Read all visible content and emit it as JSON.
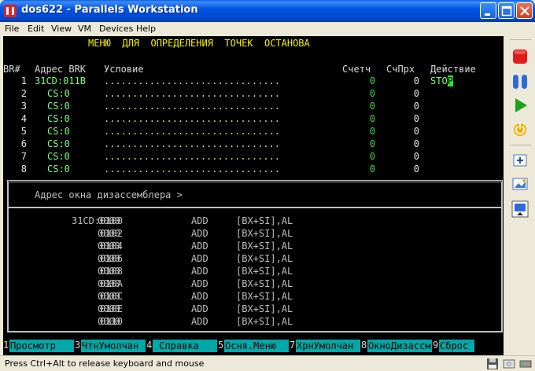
{
  "window": {
    "title": "dos622 - Parallels Workstation",
    "icon": "parallels-logo-icon"
  },
  "menu": [
    "File",
    "Edit",
    "View",
    "VM",
    "Devices",
    "Help"
  ],
  "dos": {
    "heading": "МЕНЮ  ДЛЯ  ОПРЕДЕЛЕНИЯ  ТОЧЕК  ОСТАНОВА",
    "columns": {
      "br": "BR#",
      "addr": "Адрес BRK",
      "cond": "Условие",
      "count": "Счетч",
      "pass": "СчПрх",
      "action": "Действие"
    },
    "breakpoints": [
      {
        "num": "1",
        "addr": "31CD:011B",
        "dots": "...............................",
        "count": "0",
        "pass": "0",
        "action": "STOP"
      },
      {
        "num": "2",
        "addr": "CS:0",
        "dots": "...............................",
        "count": "0",
        "pass": "0",
        "action": ""
      },
      {
        "num": "3",
        "addr": "CS:0",
        "dots": "...............................",
        "count": "0",
        "pass": "0",
        "action": ""
      },
      {
        "num": "4",
        "addr": "CS:0",
        "dots": "...............................",
        "count": "0",
        "pass": "0",
        "action": ""
      },
      {
        "num": "5",
        "addr": "CS:0",
        "dots": "...............................",
        "count": "0",
        "pass": "0",
        "action": ""
      },
      {
        "num": "6",
        "addr": "CS:0",
        "dots": "...............................",
        "count": "0",
        "pass": "0",
        "action": ""
      },
      {
        "num": "7",
        "addr": "CS:0",
        "dots": "...............................",
        "count": "0",
        "pass": "0",
        "action": ""
      },
      {
        "num": "8",
        "addr": "CS:0",
        "dots": "...............................",
        "count": "0",
        "pass": "0",
        "action": ""
      }
    ],
    "disasm_prompt": "Адрес окна дизассемблера >",
    "disasm": [
      {
        "addr": "31CD:0100",
        "bytes": "0000",
        "op": "ADD",
        "args": "[BX+SI],AL"
      },
      {
        "addr": "0102",
        "bytes": "0000",
        "op": "ADD",
        "args": "[BX+SI],AL"
      },
      {
        "addr": "0104",
        "bytes": "0000",
        "op": "ADD",
        "args": "[BX+SI],AL"
      },
      {
        "addr": "0106",
        "bytes": "0000",
        "op": "ADD",
        "args": "[BX+SI],AL"
      },
      {
        "addr": "0108",
        "bytes": "0000",
        "op": "ADD",
        "args": "[BX+SI],AL"
      },
      {
        "addr": "010A",
        "bytes": "0000",
        "op": "ADD",
        "args": "[BX+SI],AL"
      },
      {
        "addr": "010C",
        "bytes": "0000",
        "op": "ADD",
        "args": "[BX+SI],AL"
      },
      {
        "addr": "010E",
        "bytes": "0000",
        "op": "ADD",
        "args": "[BX+SI],AL"
      },
      {
        "addr": "0110",
        "bytes": "0000",
        "op": "ADD",
        "args": "[BX+SI],AL"
      }
    ],
    "fkeys": [
      {
        "num": "1",
        "label": "Просмотр"
      },
      {
        "num": "3",
        "label": "ЧтнУмолчан"
      },
      {
        "num": "4",
        "label": " Справка"
      },
      {
        "num": "5",
        "label": "Осня.Меню"
      },
      {
        "num": "7",
        "label": "ХрнУмолчан"
      },
      {
        "num": "8",
        "label": "ОкноДизассм"
      },
      {
        "num": "9",
        "label": "Сброс"
      }
    ]
  },
  "toolbar_icons": [
    "stop-icon",
    "pause-icon",
    "play-icon",
    "reset-icon",
    "fit-window-icon",
    "screenshot-icon",
    "fullscreen-icon"
  ],
  "status": {
    "text": "Press Ctrl+Alt to release keyboard and mouse",
    "icons": [
      "floppy-icon",
      "cdrom-icon",
      "harddisk-icon"
    ]
  },
  "colors": {
    "titlebar": "#0054E3",
    "dos_background": "#000000",
    "dos_heading": "#F4F400",
    "dos_green": "#33DD33",
    "fkey_label_bg": "#00A8A8"
  }
}
